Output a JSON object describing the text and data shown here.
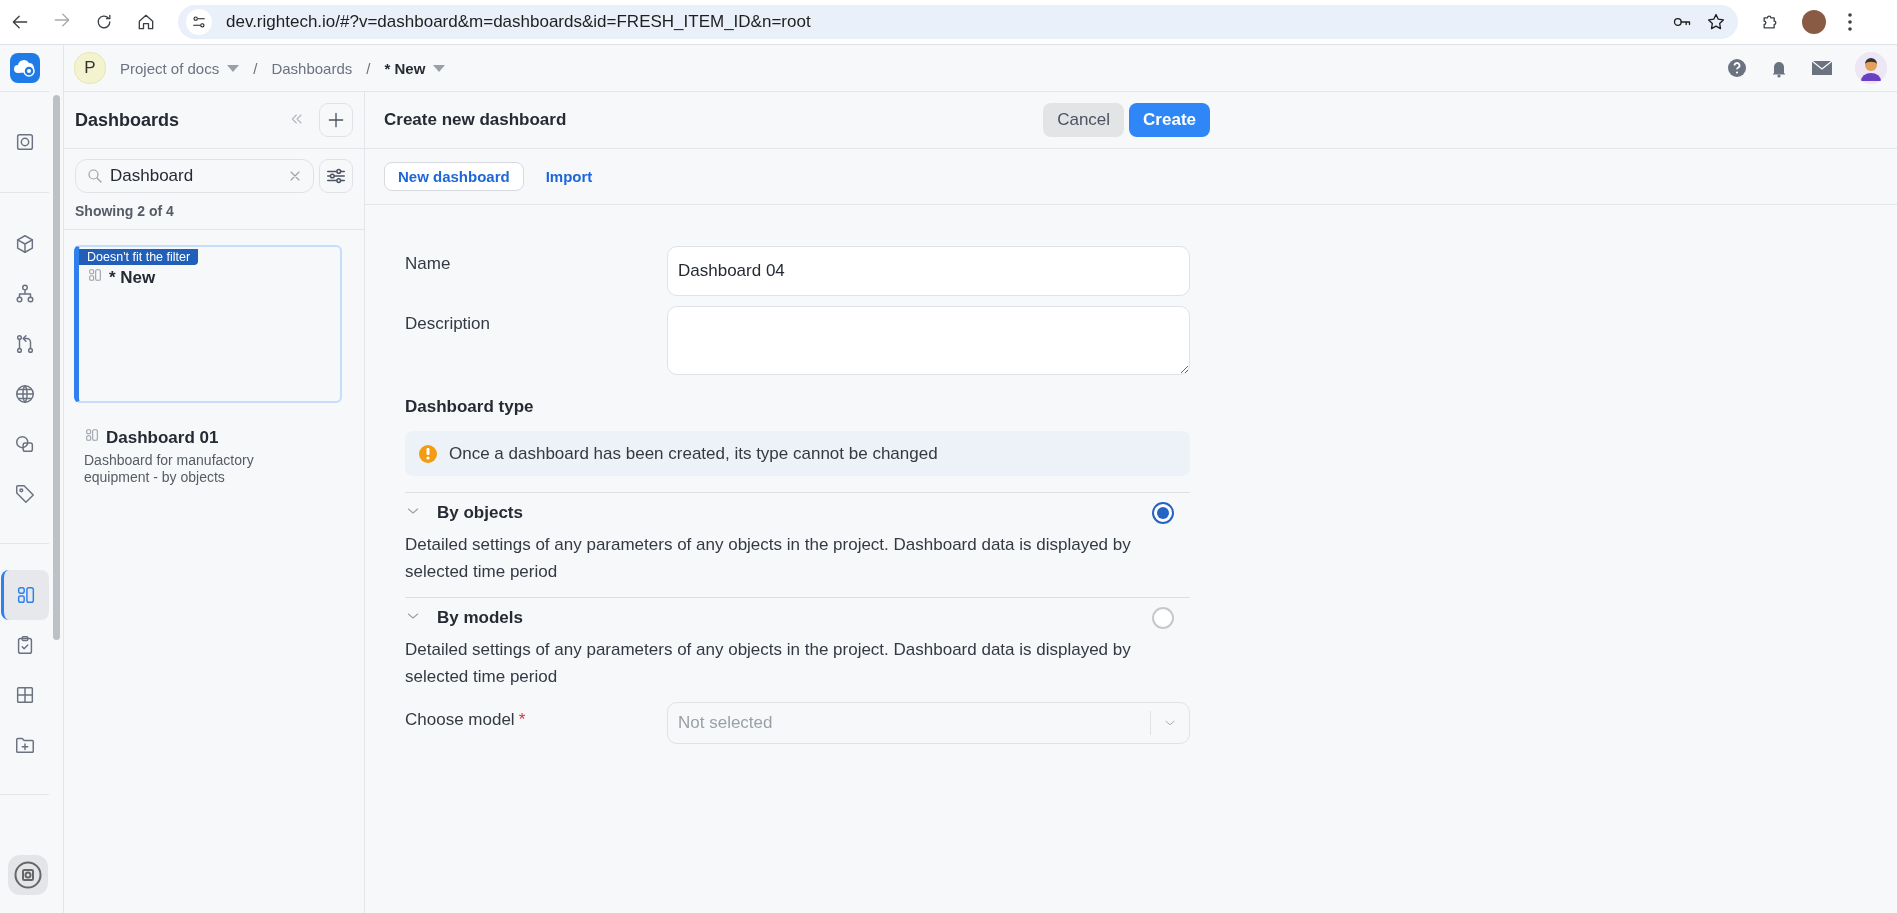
{
  "browser": {
    "url": "dev.rightech.io/#?v=dashboard&m=dashboards&id=FRESH_ITEM_ID&n=root"
  },
  "header": {
    "project_initial": "P",
    "breadcrumbs": [
      {
        "label": "Project of docs",
        "kind": "dropdown"
      },
      {
        "label": "/",
        "kind": "separator"
      },
      {
        "label": "Dashboards",
        "kind": "link"
      },
      {
        "label": "/",
        "kind": "separator"
      },
      {
        "label": "* New",
        "kind": "current"
      }
    ]
  },
  "rail": {
    "groups": [
      {
        "items": [
          {
            "kind": "device",
            "selected": false
          }
        ]
      },
      {
        "items": [
          {
            "kind": "cube",
            "selected": false
          },
          {
            "kind": "hierarchy",
            "selected": false
          },
          {
            "kind": "branch",
            "selected": false
          },
          {
            "kind": "globe",
            "selected": false
          },
          {
            "kind": "shapes",
            "selected": false
          },
          {
            "kind": "tag",
            "selected": false
          }
        ]
      },
      {
        "items": [
          {
            "kind": "dashboard",
            "selected": true
          },
          {
            "kind": "clipboard",
            "selected": false
          },
          {
            "kind": "grid",
            "selected": false
          },
          {
            "kind": "folder",
            "selected": false
          }
        ]
      }
    ]
  },
  "panel": {
    "title": "Dashboards",
    "search": {
      "value": "Dashboard"
    },
    "count": "Showing 2 of 4",
    "items": [
      {
        "title": "* New",
        "badge": "Doesn't fit the filter",
        "selected": true
      },
      {
        "title": "Dashboard 01",
        "description": "Dashboard for manufactory equipment - by objects",
        "selected": false
      }
    ]
  },
  "main": {
    "title": "Create new dashboard",
    "buttons": [
      {
        "label": "Cancel",
        "kind": "secondary"
      },
      {
        "label": "Create",
        "kind": "primary"
      }
    ],
    "tabs": [
      {
        "label": "New dashboard",
        "selected": true
      },
      {
        "label": "Import",
        "selected": false
      }
    ],
    "form": {
      "name": {
        "label": "Name",
        "value": "Dashboard 04"
      },
      "description": {
        "label": "Description"
      },
      "type_heading": "Dashboard type",
      "notice": "Once a dashboard has been created, its type cannot be changed",
      "options": [
        {
          "title": "By objects",
          "description": "Detailed settings of any parameters of any objects in the project. Dashboard data is displayed by selected time period",
          "selected": true
        },
        {
          "title": "By models",
          "description": "Detailed settings of any parameters of any objects in the project. Dashboard data is displayed by selected time period",
          "selected": false
        }
      ],
      "model": {
        "label": "Choose model",
        "required": "*",
        "placeholder": "Not selected"
      }
    }
  }
}
